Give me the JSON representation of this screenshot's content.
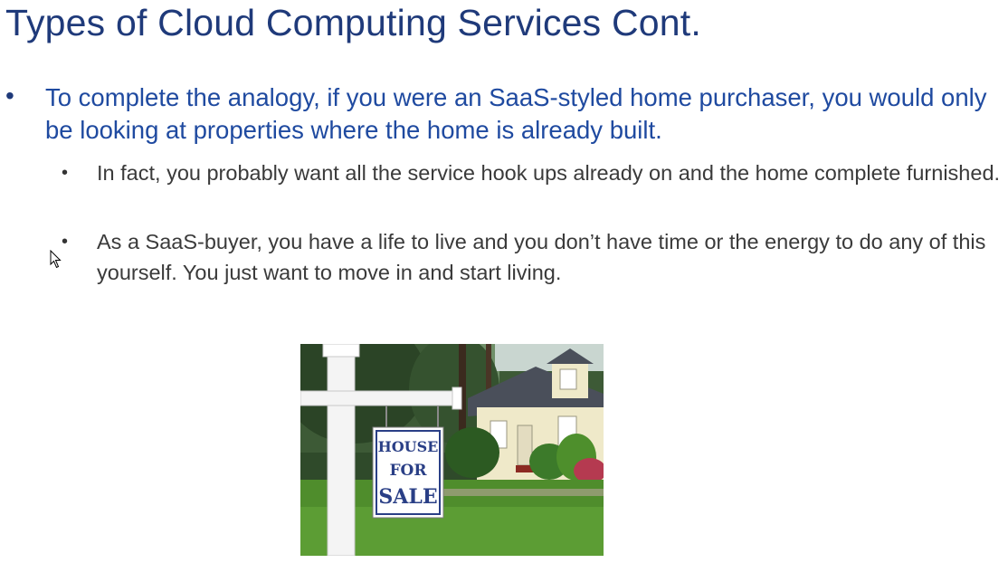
{
  "slide": {
    "title": "Types of Cloud Computing Services Cont.",
    "bullets": [
      {
        "text": "To complete the analogy, if you were an SaaS-styled home purchaser, you would only be looking at properties where the home is already built.",
        "subbullets": [
          "In fact, you probably want all the service hook ups already on and the home complete furnished.",
          "As a SaaS-buyer, you have a life to live and you don’t have time or the energy to do any of this yourself.  You just want to move in and start living."
        ]
      }
    ],
    "image": {
      "sign_lines": [
        "HOUSE",
        "FOR",
        "SALE"
      ]
    }
  },
  "colors": {
    "title": "#1f3a7a",
    "bullet_level1": "#1f4aa0",
    "bullet_level2": "#3a3a3a"
  }
}
